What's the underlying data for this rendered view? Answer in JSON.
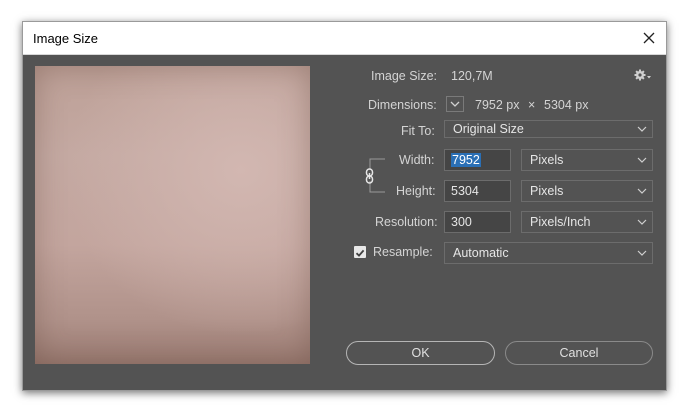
{
  "window": {
    "title": "Image Size"
  },
  "info": {
    "image_size_label": "Image Size:",
    "image_size_value": "120,7M",
    "dimensions_label": "Dimensions:",
    "dimensions_width": "7952 px",
    "dimensions_separator": "×",
    "dimensions_height": "5304 px"
  },
  "fit_to": {
    "label": "Fit To:",
    "value": "Original Size"
  },
  "width": {
    "label": "Width:",
    "value": "7952",
    "unit": "Pixels"
  },
  "height": {
    "label": "Height:",
    "value": "5304",
    "unit": "Pixels"
  },
  "resolution": {
    "label": "Resolution:",
    "value": "300",
    "unit": "Pixels/Inch"
  },
  "resample": {
    "label": "Resample:",
    "checked": true,
    "value": "Automatic"
  },
  "buttons": {
    "ok": "OK",
    "cancel": "Cancel"
  }
}
